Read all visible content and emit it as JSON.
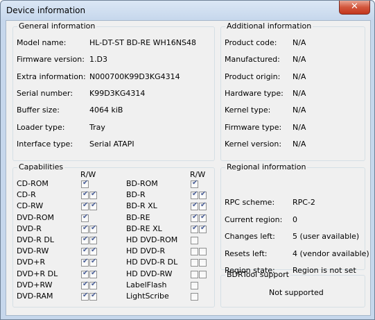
{
  "window": {
    "title": "Device information",
    "close_icon": "✕"
  },
  "general": {
    "title": "General information",
    "rows": [
      {
        "label": "Model name:",
        "value": "HL-DT-ST BD-RE  WH16NS48"
      },
      {
        "label": "Firmware version:",
        "value": "1.D3"
      },
      {
        "label": "Extra information:",
        "value": "N000700K99D3KG4314"
      },
      {
        "label": "Serial number:",
        "value": "K99D3KG4314"
      },
      {
        "label": "Buffer size:",
        "value": "4064 kiB"
      },
      {
        "label": "Loader type:",
        "value": "Tray"
      },
      {
        "label": "Interface type:",
        "value": "Serial ATAPI"
      }
    ]
  },
  "additional": {
    "title": "Additional information",
    "rows": [
      {
        "label": "Product code:",
        "value": "N/A"
      },
      {
        "label": "Manufactured:",
        "value": "N/A"
      },
      {
        "label": "Product origin:",
        "value": "N/A"
      },
      {
        "label": "Hardware type:",
        "value": "N/A"
      },
      {
        "label": "Kernel type:",
        "value": "N/A"
      },
      {
        "label": "Firmware type:",
        "value": "N/A"
      },
      {
        "label": "Kernel version:",
        "value": "N/A"
      }
    ]
  },
  "capabilities": {
    "title": "Capabilities",
    "rw_header": "R/W",
    "left": [
      {
        "name": "CD-ROM",
        "r": true,
        "w": null
      },
      {
        "name": "CD-R",
        "r": true,
        "w": true
      },
      {
        "name": "CD-RW",
        "r": true,
        "w": true
      },
      {
        "name": "DVD-ROM",
        "r": true,
        "w": null
      },
      {
        "name": "DVD-R",
        "r": true,
        "w": true
      },
      {
        "name": "DVD-R DL",
        "r": true,
        "w": true
      },
      {
        "name": "DVD-RW",
        "r": true,
        "w": true
      },
      {
        "name": "DVD+R",
        "r": true,
        "w": true
      },
      {
        "name": "DVD+R DL",
        "r": true,
        "w": true
      },
      {
        "name": "DVD+RW",
        "r": true,
        "w": true
      },
      {
        "name": "DVD-RAM",
        "r": true,
        "w": true
      }
    ],
    "right": [
      {
        "name": "BD-ROM",
        "r": true,
        "w": null
      },
      {
        "name": "BD-R",
        "r": true,
        "w": true
      },
      {
        "name": "BD-R XL",
        "r": true,
        "w": true
      },
      {
        "name": "BD-RE",
        "r": true,
        "w": true
      },
      {
        "name": "BD-RE XL",
        "r": true,
        "w": true
      },
      {
        "name": "HD DVD-ROM",
        "r": false,
        "w": null
      },
      {
        "name": "HD DVD-R",
        "r": false,
        "w": false
      },
      {
        "name": "HD DVD-R DL",
        "r": false,
        "w": false
      },
      {
        "name": "HD DVD-RW",
        "r": false,
        "w": false
      },
      {
        "name": "LabelFlash",
        "r": false,
        "w": null
      },
      {
        "name": "LightScribe",
        "r": false,
        "w": null
      }
    ]
  },
  "regional": {
    "title": "Regional information",
    "rows": [
      {
        "label": "RPC scheme:",
        "value": "RPC-2"
      },
      {
        "label": "Current region:",
        "value": "0"
      },
      {
        "label": "Changes left:",
        "value": "5 (user available)"
      },
      {
        "label": "Resets left:",
        "value": "4 (vendor available)"
      },
      {
        "label": "Region state:",
        "value": "Region is not set"
      }
    ]
  },
  "bdrtool": {
    "title": "BDRTool support",
    "status": "Not supported"
  }
}
